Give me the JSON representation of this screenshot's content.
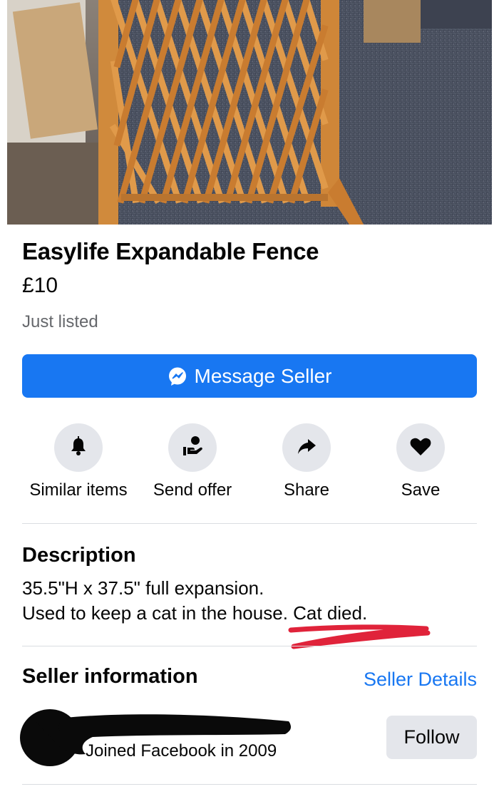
{
  "listing": {
    "title": "Easylife Expandable Fence",
    "price": "£10",
    "status": "Just listed",
    "photo": "wooden-lattice-fence-photo"
  },
  "primary_action": {
    "label": "Message Seller",
    "icon": "messenger-icon",
    "color": "#1877f2"
  },
  "actions": [
    {
      "label": "Similar items",
      "icon": "bell-icon"
    },
    {
      "label": "Send offer",
      "icon": "offer-hand-icon"
    },
    {
      "label": "Share",
      "icon": "share-arrow-icon"
    },
    {
      "label": "Save",
      "icon": "heart-icon"
    }
  ],
  "description": {
    "heading": "Description",
    "line1": "35.5\"H x 37.5\" full expansion.",
    "line2": "Used to keep a cat in the house. Cat died."
  },
  "seller": {
    "heading": "Seller information",
    "details_link": "Seller Details",
    "joined": "Joined Facebook in 2009",
    "follow_label": "Follow"
  },
  "colors": {
    "accent": "#1877f2",
    "secondary_text": "#65676b",
    "button_gray": "#e4e6eb",
    "annotation_red": "#e0233a"
  }
}
